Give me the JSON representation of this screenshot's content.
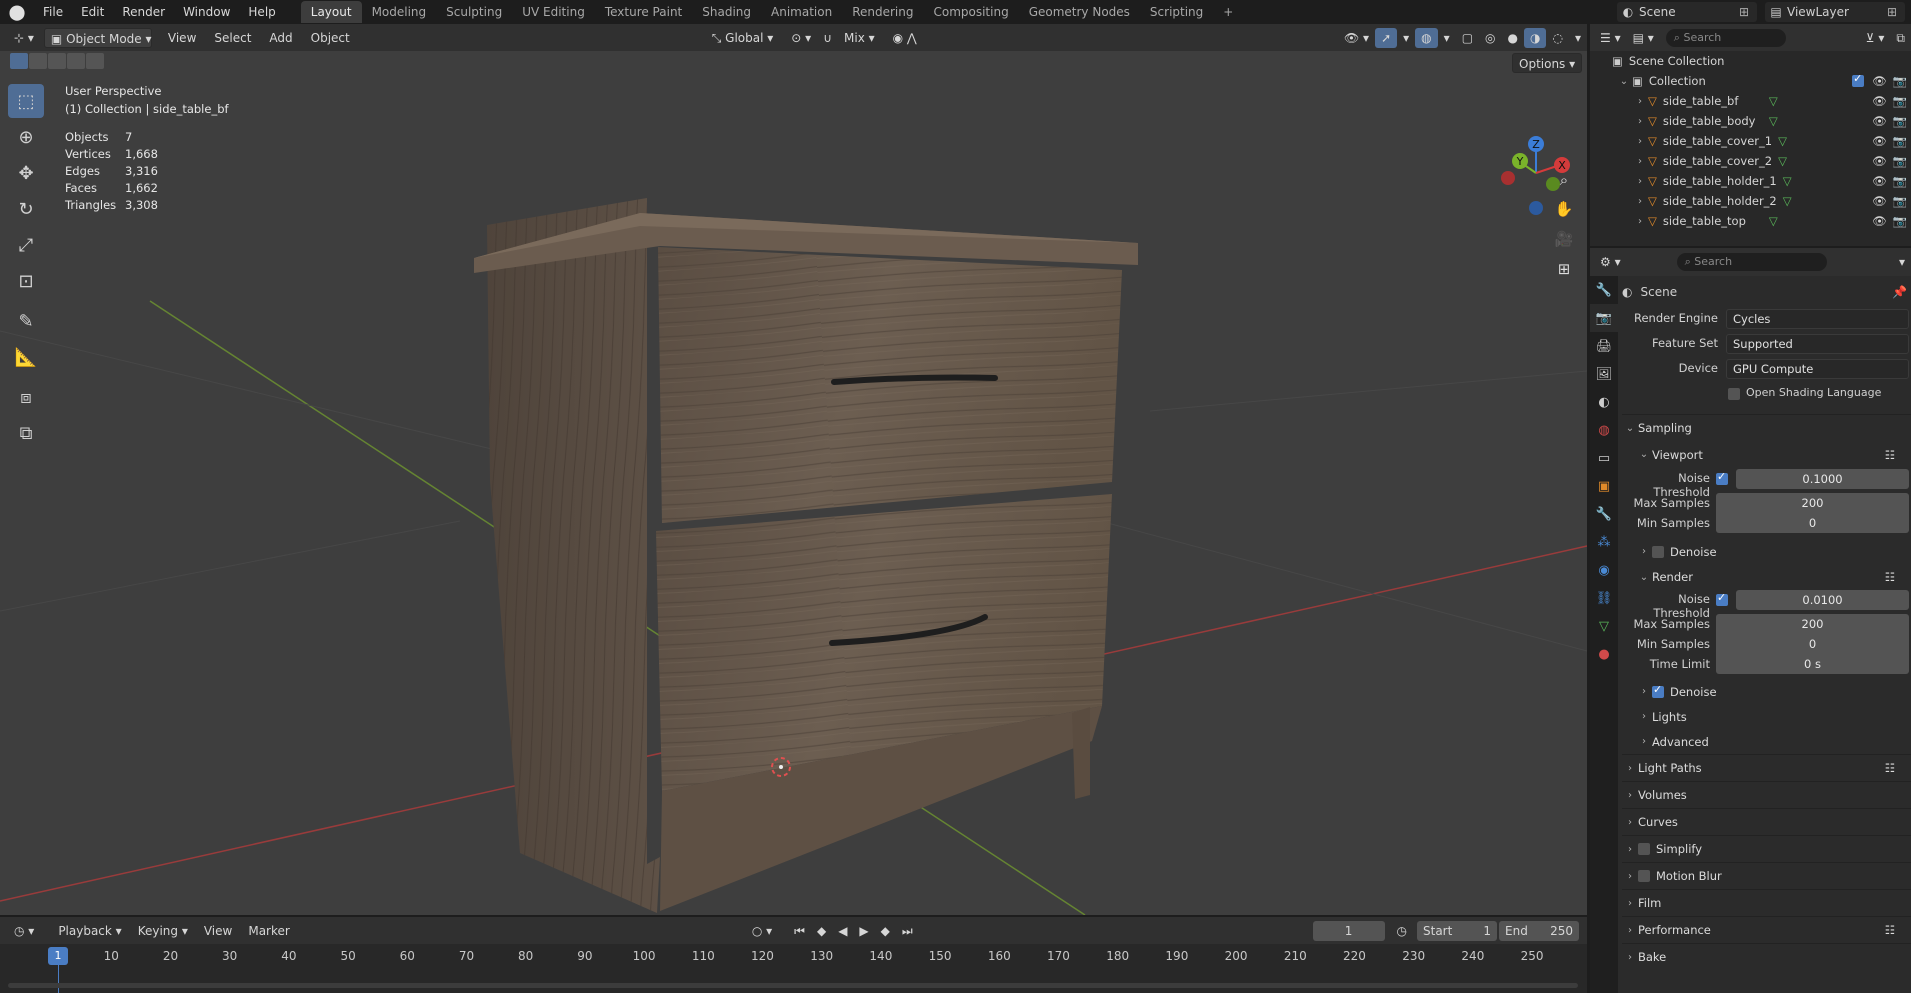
{
  "menu": [
    "File",
    "Edit",
    "Render",
    "Window",
    "Help"
  ],
  "workspaces": [
    "Layout",
    "Modeling",
    "Sculpting",
    "UV Editing",
    "Texture Paint",
    "Shading",
    "Animation",
    "Rendering",
    "Compositing",
    "Geometry Nodes",
    "Scripting"
  ],
  "active_workspace": "Layout",
  "scene_name": "Scene",
  "view_layer": "ViewLayer",
  "viewport_header": {
    "mode": "Object Mode",
    "menus": [
      "View",
      "Select",
      "Add",
      "Object"
    ],
    "orientation": "Global",
    "snap_target": "Mix",
    "options": "Options"
  },
  "overlay": {
    "view_name": "User Perspective",
    "collection_path": "(1) Collection | side_table_bf",
    "stats": [
      {
        "label": "Objects",
        "value": "7"
      },
      {
        "label": "Vertices",
        "value": "1,668"
      },
      {
        "label": "Edges",
        "value": "3,316"
      },
      {
        "label": "Faces",
        "value": "1,662"
      },
      {
        "label": "Triangles",
        "value": "3,308"
      }
    ]
  },
  "gizmo_axes": {
    "x": "X",
    "y": "Y",
    "z": "Z"
  },
  "outliner": {
    "search_placeholder": "Search",
    "scene_collection": "Scene Collection",
    "collection": "Collection",
    "objects": [
      "side_table_bf",
      "side_table_body",
      "side_table_cover_1",
      "side_table_cover_2",
      "side_table_holder_1",
      "side_table_holder_2",
      "side_table_top"
    ]
  },
  "properties": {
    "search_placeholder": "Search",
    "context": "Scene",
    "render_engine_label": "Render Engine",
    "render_engine": "Cycles",
    "feature_set_label": "Feature Set",
    "feature_set": "Supported",
    "device_label": "Device",
    "device": "GPU Compute",
    "osl_label": "Open Shading Language",
    "sampling": "Sampling",
    "viewport": "Viewport",
    "noise_threshold_label": "Noise Threshold",
    "vp_noise_threshold": "0.1000",
    "max_samples_label": "Max Samples",
    "vp_max_samples": "200",
    "min_samples_label": "Min Samples",
    "vp_min_samples": "0",
    "denoise_label": "Denoise",
    "render": "Render",
    "r_noise_threshold": "0.0100",
    "r_max_samples": "200",
    "r_min_samples": "0",
    "time_limit_label": "Time Limit",
    "r_time_limit": "0 s",
    "lights": "Lights",
    "advanced": "Advanced",
    "panels": [
      "Light Paths",
      "Volumes",
      "Curves",
      "Simplify",
      "Motion Blur",
      "Film",
      "Performance",
      "Bake"
    ]
  },
  "timeline": {
    "menus": [
      "Playback",
      "Keying",
      "View",
      "Marker"
    ],
    "current_frame": "1",
    "start_label": "Start",
    "start": "1",
    "end_label": "End",
    "end": "250",
    "ruler": [
      "1",
      "10",
      "20",
      "30",
      "40",
      "50",
      "60",
      "70",
      "80",
      "90",
      "100",
      "110",
      "120",
      "130",
      "140",
      "150",
      "160",
      "170",
      "180",
      "190",
      "200",
      "210",
      "220",
      "230",
      "240",
      "250"
    ]
  },
  "colors": {
    "accent": "#4f6d95",
    "x_axis": "#c63a3a",
    "y_axis": "#6a9a2a",
    "wood": "#6d5e50",
    "selected_frame": "#4a7dc4"
  }
}
